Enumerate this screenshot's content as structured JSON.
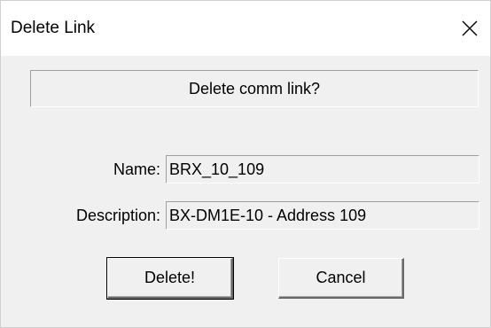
{
  "window": {
    "title": "Delete Link",
    "close_icon": "close-icon"
  },
  "prompt": {
    "text": "Delete comm link?"
  },
  "fields": {
    "name_label": "Name:",
    "name_value": "BRX_10_109",
    "description_label": "Description:",
    "description_value": "BX-DM1E-10 - Address 109"
  },
  "buttons": {
    "delete_label": "Delete!",
    "cancel_label": "Cancel"
  },
  "colors": {
    "dialog_background": "#f0f0f0",
    "titlebar_background": "#ffffff",
    "text": "#000000"
  }
}
